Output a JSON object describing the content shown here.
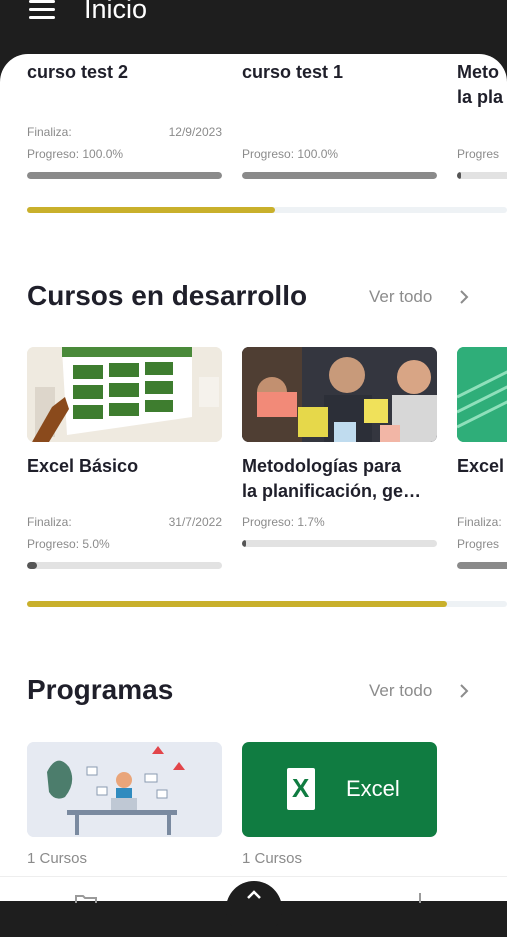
{
  "header": {
    "title": "Inicio",
    "menu_icon": "hamburger-menu-icon"
  },
  "completed": {
    "cards": [
      {
        "title": "curso test 2",
        "ends_label": "Finaliza:",
        "ends_date": "12/9/2023",
        "progress_label": "Progreso: 100.0%",
        "progress": 1.0
      },
      {
        "title": "curso test 1",
        "progress_label": "Progreso: 100.0%",
        "progress": 1.0
      },
      {
        "title_line1": "Meto",
        "title_line2": "la pla",
        "progress_label": "Progres",
        "progress": 0.02
      }
    ],
    "scroll_thumb_fraction": 0.5
  },
  "in_progress": {
    "title": "Cursos en desarrollo",
    "see_all": "Ver todo",
    "cards": [
      {
        "title": "Excel Básico",
        "ends_label": "Finaliza:",
        "ends_date": "31/7/2022",
        "progress_label": "Progreso: 5.0%",
        "progress": 0.05,
        "thumb": "excel-spreadsheet-illustration"
      },
      {
        "title_line1": "Metodologías para",
        "title_line2": "la planificación, ge…",
        "progress_label": "Progreso: 1.7%",
        "progress": 0.017,
        "thumb": "team-sticky-notes-photo"
      },
      {
        "title": "Excel",
        "ends_label": "Finaliza:",
        "progress_label": "Progres",
        "progress": 0.3,
        "thumb": "green-spreadsheet"
      }
    ],
    "scroll_thumb_fraction": 0.9
  },
  "programs": {
    "title": "Programas",
    "see_all": "Ver todo",
    "cards": [
      {
        "count": "1 Cursos",
        "thumb": "office-worker-illustration"
      },
      {
        "count": "1 Cursos",
        "logo_text": "Excel",
        "logo_letter": "X"
      }
    ]
  },
  "colors": {
    "accent": "#c9b02b",
    "excel_green": "#107c41",
    "dark": "#1e1e1e"
  }
}
